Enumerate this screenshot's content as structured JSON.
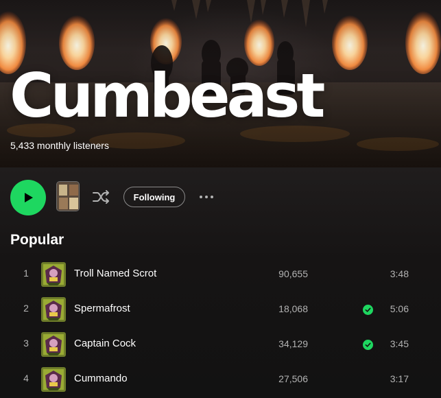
{
  "artist": {
    "name": "Cumbeast",
    "monthly_listeners": "5,433 monthly listeners"
  },
  "actions": {
    "play_icon": "play-icon",
    "shuffle_icon": "shuffle-icon",
    "follow_label": "Following",
    "more_icon": "more-options-icon"
  },
  "popular": {
    "heading": "Popular",
    "tracks": [
      {
        "number": "1",
        "title": "Troll Named Scrot",
        "plays": "90,655",
        "saved": false,
        "duration": "3:48"
      },
      {
        "number": "2",
        "title": "Spermafrost",
        "plays": "18,068",
        "saved": true,
        "duration": "5:06"
      },
      {
        "number": "3",
        "title": "Captain Cock",
        "plays": "34,129",
        "saved": true,
        "duration": "3:45"
      },
      {
        "number": "4",
        "title": "Cummando",
        "plays": "27,506",
        "saved": false,
        "duration": "3:17"
      }
    ]
  },
  "colors": {
    "accent": "#1ed760",
    "background": "#121212",
    "secondary_text": "#b3b3b3"
  }
}
